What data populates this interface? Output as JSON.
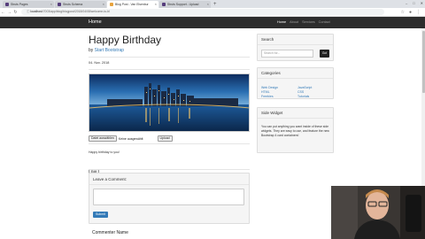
{
  "browser": {
    "tabs": [
      {
        "label": "Struts Pages",
        "active": false
      },
      {
        "label": "Struts Schema",
        "active": false
      },
      {
        "label": "Blog Post - Van Elsenbur",
        "active": true
      },
      {
        "label": "Struts Support - Upload",
        "active": false
      }
    ],
    "new_tab": "+",
    "url_prefix": "localhost",
    "url_path": ":7003/app/blog/blogpost/2018/04/08/welcome-to-bl",
    "window_controls": [
      "–",
      "□",
      "✕"
    ]
  },
  "navbar": {
    "brand": "Home",
    "links": [
      {
        "label": "Home",
        "active": true
      },
      {
        "label": "About",
        "active": false
      },
      {
        "label": "Services",
        "active": false
      },
      {
        "label": "Contact",
        "active": false
      }
    ]
  },
  "post": {
    "title": "Happy Birthday",
    "by": "by",
    "author": "Start Bootstrap",
    "date": "04. Nov. 2018",
    "choose_file": "Datei auswählen",
    "no_file": "Keine ausgewählt",
    "upload": "Upload",
    "body": "Happy birthday to you!",
    "edit": "Edit"
  },
  "comment": {
    "title": "Leave a Comment:",
    "submit": "Submit",
    "commenter_label": "Commenter Name"
  },
  "sidebar": {
    "search_title": "Search",
    "search_placeholder": "Search for...",
    "go": "Go!",
    "categories_title": "Categories",
    "categories_left": [
      "Web Design",
      "HTML",
      "Freebies"
    ],
    "categories_right": [
      "JavaScript",
      "CSS",
      "Tutorials"
    ],
    "widget_title": "Side Widget",
    "widget_text": "You can put anything you want inside of these side widgets. They are easy to use, and feature the new Bootstrap 4 card containers!"
  },
  "colors": {
    "link": "#337ab7",
    "navbar": "#2d2d2d",
    "primary": "#337ab7"
  }
}
